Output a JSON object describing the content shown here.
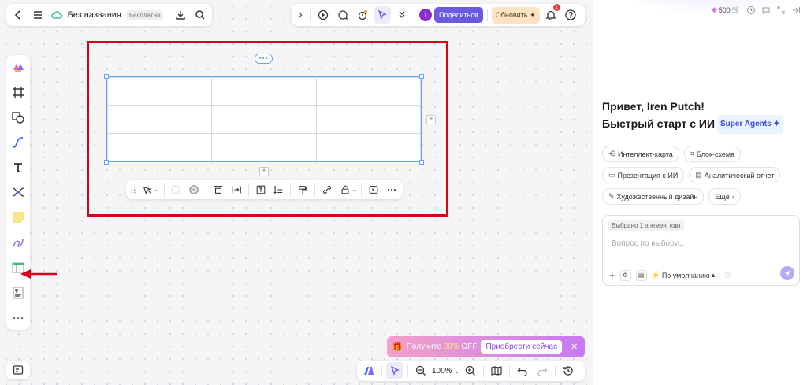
{
  "topbar": {
    "doc_title": "Без названия",
    "plan_badge": "Бесплатно",
    "avatar_letter": "I",
    "share_label": "Поделиться",
    "upgrade_label": "Обновить ✦",
    "notifications_count": "1"
  },
  "left_tools": [
    "brand-logo-icon",
    "frame-icon",
    "shapes-icon",
    "connector-icon",
    "text-icon",
    "mindmap-icon",
    "sticky-note-icon",
    "pen-icon",
    "table-icon",
    "text-template-icon",
    "more-icon"
  ],
  "table": {
    "rows": 3,
    "cols": 3
  },
  "promo": {
    "prefix": "Получите ",
    "discount": "80%",
    "suffix": " OFF",
    "button": "Приобрести сейчас",
    "close": "✕"
  },
  "bottombar": {
    "zoom": "100%"
  },
  "right_panel": {
    "credits": "500",
    "greeting_line1": "Привет, Iren Putch!",
    "greeting_line2": "Быстрый старт с ИИ",
    "agents_badge": "Super Agents ✦",
    "chips": [
      {
        "icon": "⋲",
        "label": "Интеллект-карта"
      },
      {
        "icon": "⌗",
        "label": "Блок-схема"
      },
      {
        "icon": "▭",
        "label": "Презентация с ИИ"
      },
      {
        "icon": "▤",
        "label": "Аналитический отчет"
      },
      {
        "icon": "✎",
        "label": "Художественный дизайн"
      },
      {
        "icon": "›",
        "label": "Ещё"
      }
    ],
    "chat": {
      "selected_tag": "Выбрано 1 элемент(ов)",
      "placeholder": "Вопрос по выбору...",
      "model_label": "По умолчанию"
    }
  },
  "colors": {
    "accent": "#6a5ae0",
    "highlight_red": "#d9001b",
    "selection_blue": "#64a7ec"
  }
}
